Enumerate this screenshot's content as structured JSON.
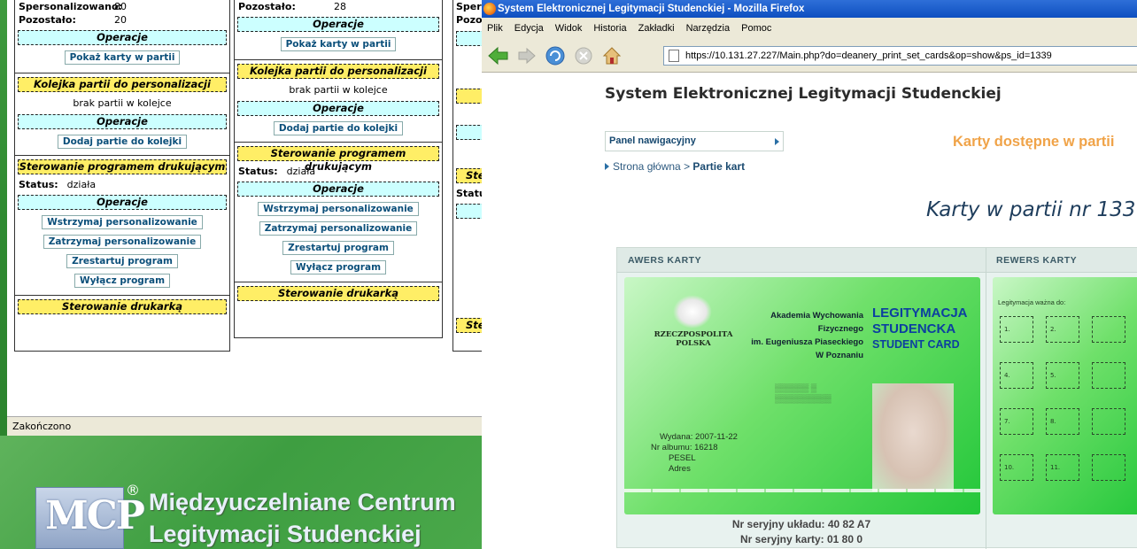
{
  "background_window": {
    "panel1": {
      "personalized_label": "Spersonalizowano:",
      "personalized_value": "80",
      "remaining_label": "Pozostało:",
      "remaining_value": "20",
      "ops_header": "Operacje",
      "show_cards": "Pokaż karty w partii",
      "queue_header": "Kolejka partii do personalizacji",
      "queue_empty": "brak partii w kolejce",
      "ops_header2": "Operacje",
      "add_to_queue": "Dodaj partie do kolejki",
      "printer_prog_header": "Sterowanie programem drukującym",
      "status_label": "Status:",
      "status_value": "działa",
      "ops_header3": "Operacje",
      "pause": "Wstrzymaj personalizowanie",
      "stop": "Zatrzymaj personalizowanie",
      "restart": "Zrestartuj program",
      "shutdown": "Wyłącz program",
      "printer_header": "Sterowanie drukarką"
    },
    "panel2": {
      "remaining_label": "Pozostało:",
      "remaining_value": "28",
      "ops_header": "Operacje",
      "show_cards": "Pokaż karty w partii",
      "queue_header": "Kolejka partii do personalizacji",
      "queue_empty": "brak partii w kolejce",
      "ops_header2": "Operacje",
      "add_to_queue": "Dodaj partie do kolejki",
      "printer_prog_header": "Sterowanie programem drukującym",
      "status_label": "Status:",
      "status_value": "działa",
      "ops_header3": "Operacje",
      "pause": "Wstrzymaj personalizowanie",
      "stop": "Zatrzymaj personalizowanie",
      "restart": "Zrestartuj program",
      "shutdown": "Wyłącz program",
      "printer_header": "Sterowanie drukarką"
    },
    "panel3": {
      "frag1": "Sper",
      "frag2": "Pozo",
      "frag3": "Ste",
      "frag4": "Statu",
      "frag5": "Ste"
    },
    "statusbar": "Zakończono"
  },
  "logo": {
    "mark": "MCP",
    "registered": "®",
    "line1": "Międzyuczelniane Centrum",
    "line2": "Legitymacji Studenckiej"
  },
  "firefox": {
    "title": "System Elektronicznej Legitymacji Studenckiej - Mozilla Firefox",
    "menu": [
      "Plik",
      "Edycja",
      "Widok",
      "Historia",
      "Zakładki",
      "Narzędzia",
      "Pomoc"
    ],
    "url": "https://10.131.27.227/Main.php?do=deanery_print_set_cards&op=show&ps_id=1339"
  },
  "page": {
    "site_title": "System Elektronicznej Legitymacji Studenckiej",
    "nav_panel": "Panel nawigacyjny",
    "section_title": "Karty dostępne w partii",
    "breadcrumb_home": "Strona główna",
    "breadcrumb_sep": ">",
    "breadcrumb_current": "Partie kart",
    "big_title": "Karty w partii nr 133",
    "col_front": "AWERS KARTY",
    "col_back": "REWERS KARTY",
    "card": {
      "rp1": "RZECZPOSPOLITA",
      "rp2": "POLSKA",
      "uni1": "Akademia Wychowania",
      "uni2": "Fizycznego",
      "uni3": "im. Eugeniusza Piaseckiego",
      "uni4": "W Poznaniu",
      "leg1": "LEGITYMACJA",
      "leg2": "STUDENCKA",
      "leg3": "STUDENT CARD",
      "issued": "Wydana: 2007-11-22",
      "album": "Nr albumu: 16218",
      "pesel": "PESEL",
      "address": "Adres",
      "back_label": "Legitymacja ważna do:",
      "back_numbers": [
        "1.",
        "2.",
        "4.",
        "5.",
        "7.",
        "8.",
        "10.",
        "11."
      ]
    },
    "serial_chip": "Nr seryjny układu: 40 82 A7",
    "serial_card": "Nr seryjny karty: 01 80 0"
  },
  "colors": {
    "title_orange": "#f0a348",
    "link_blue": "#0b4f7a",
    "header_cyan": "#ccffff",
    "header_yellow": "#ffee66",
    "xp_blue": "#0e4fc0"
  }
}
